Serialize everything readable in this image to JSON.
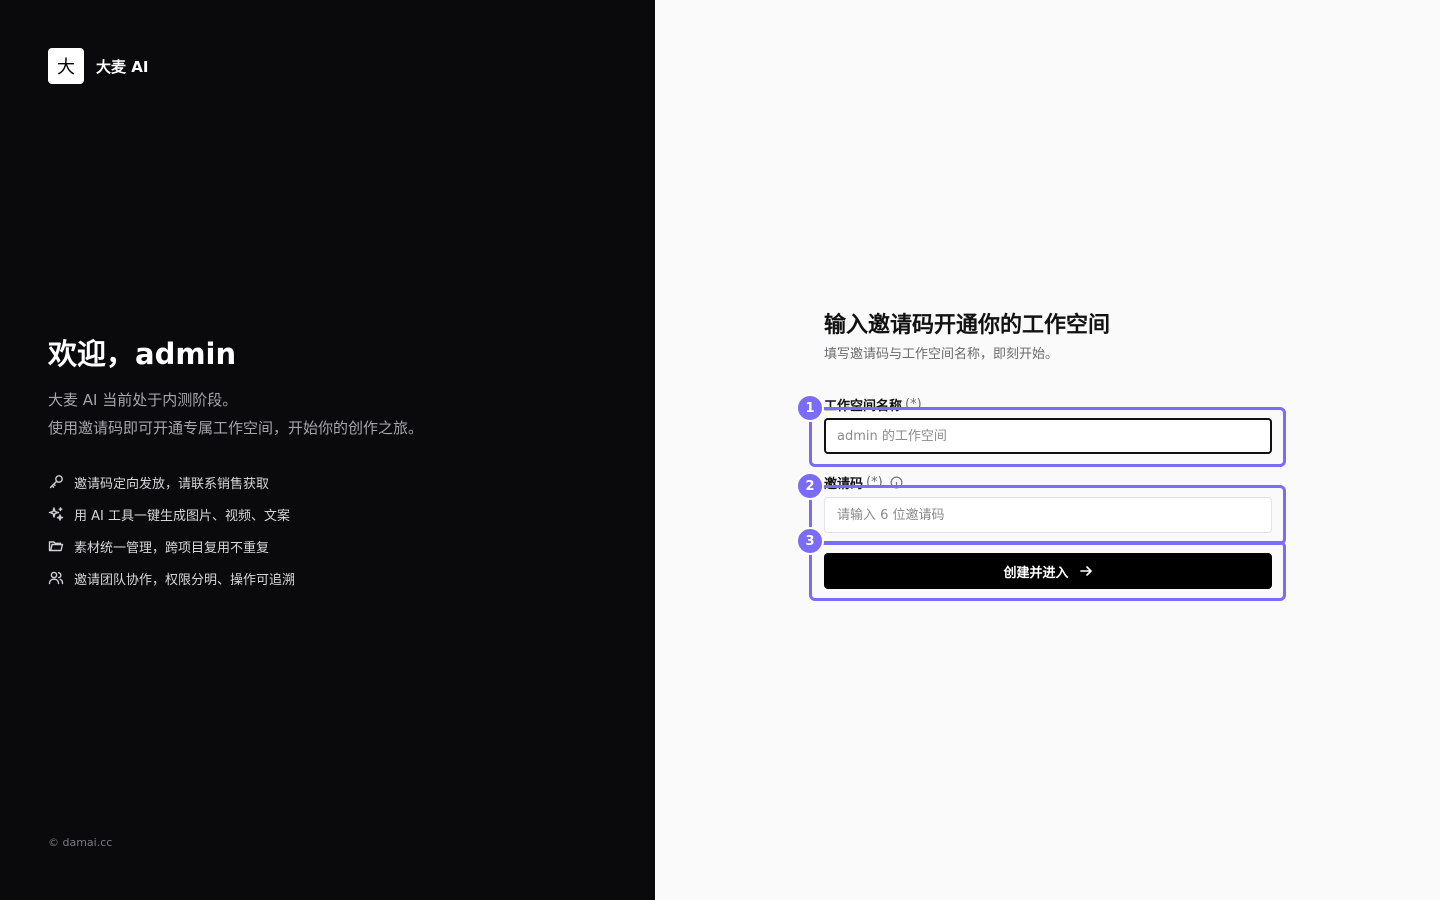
{
  "brand": {
    "logo_char": "大",
    "name": "大麦 AI"
  },
  "welcome": {
    "title": "欢迎，admin",
    "line1": "大麦 AI 当前处于内测阶段。",
    "line2": "使用邀请码即可开通专属工作空间，开始你的创作之旅。"
  },
  "features": [
    {
      "icon": "key-icon",
      "text": "邀请码定向发放，请联系销售获取"
    },
    {
      "icon": "sparkles-icon",
      "text": "用 AI 工具一键生成图片、视频、文案"
    },
    {
      "icon": "folder-icon",
      "text": "素材统一管理，跨项目复用不重复"
    },
    {
      "icon": "users-icon",
      "text": "邀请团队协作，权限分明、操作可追溯"
    }
  ],
  "copyright": "© damai.cc",
  "form": {
    "title": "输入邀请码开通你的工作空间",
    "subtitle": "填写邀请码与工作空间名称，即刻开始。",
    "workspace_label": "工作空间名称",
    "workspace_required": "(*)",
    "workspace_placeholder": "admin 的工作空间",
    "code_label": "邀请码",
    "code_required": "(*)",
    "code_placeholder": "请输入 6 位邀请码",
    "submit_label": "创建并进入"
  },
  "annotations": [
    "1",
    "2",
    "3"
  ],
  "colors": {
    "annotation": "#7a6cf5",
    "left_bg": "#0a0a0c",
    "button": "#000000"
  }
}
